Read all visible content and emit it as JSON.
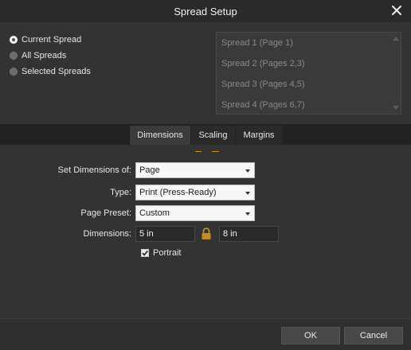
{
  "window": {
    "title": "Spread Setup"
  },
  "scope": {
    "options": [
      {
        "label": "Current Spread",
        "checked": true
      },
      {
        "label": "All Spreads",
        "checked": false
      },
      {
        "label": "Selected Spreads",
        "checked": false
      }
    ]
  },
  "spreads": {
    "items": [
      "Spread 1 (Page 1)",
      "Spread 2 (Pages 2,3)",
      "Spread 3 (Pages 4,5)",
      "Spread 4 (Pages 6,7)"
    ]
  },
  "tabs": [
    {
      "label": "Dimensions",
      "active": true
    },
    {
      "label": "Scaling",
      "active": false
    },
    {
      "label": "Margins",
      "active": false
    }
  ],
  "form": {
    "set_dimensions_label": "Set Dimensions of:",
    "set_dimensions_value": "Page",
    "type_label": "Type:",
    "type_value": "Print (Press-Ready)",
    "preset_label": "Page Preset:",
    "preset_value": "Custom",
    "dimensions_label": "Dimensions:",
    "width_value": "5 in",
    "height_value": "8 in",
    "portrait_label": "Portrait",
    "portrait_checked": true
  },
  "footer": {
    "ok_label": "OK",
    "cancel_label": "Cancel"
  },
  "colors": {
    "background": "#333333",
    "lock_accent": "#c28d1e"
  }
}
